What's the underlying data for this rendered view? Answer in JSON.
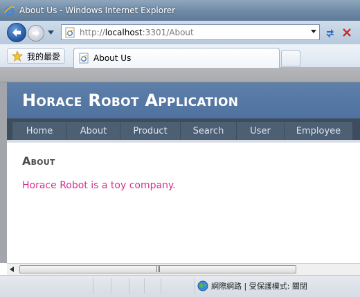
{
  "window": {
    "title": "About Us - Windows Internet Explorer"
  },
  "address": {
    "scheme_prefix": "http://",
    "host": "localhost",
    "rest": ":3301/About"
  },
  "tabs": {
    "favorites_label": "我的最愛",
    "active_tab_title": "About Us"
  },
  "site": {
    "title": "Horace Robot Application",
    "menu": [
      "Home",
      "About",
      "Product",
      "Search",
      "User",
      "Employee"
    ]
  },
  "page": {
    "heading": "About",
    "body_text": "Horace Robot is a toy company."
  },
  "status": {
    "zone_text": "網際網路 | 受保護模式: 關閉"
  },
  "colors": {
    "header_blue": "#4f729f",
    "menu_dark": "#3e4d5d",
    "link_pink": "#d52f8f"
  }
}
